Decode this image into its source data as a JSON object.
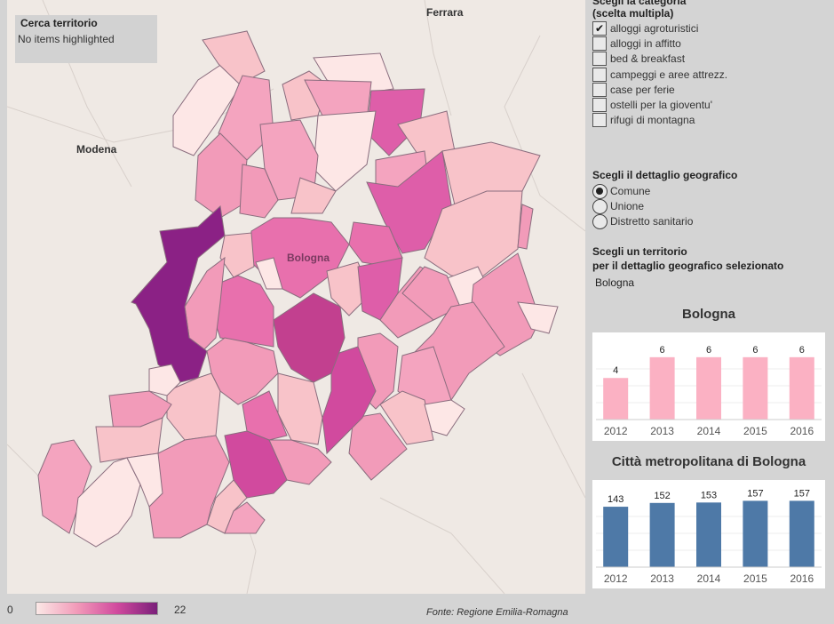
{
  "search": {
    "title": "Cerca territorio",
    "status": "No items highlighted"
  },
  "map": {
    "cities": {
      "modena": "Modena",
      "ferrara": "Ferrara",
      "bologna": "Bologna"
    },
    "legend": {
      "min": "0",
      "max": "22"
    },
    "source": "Fonte: Regione Emilia-Romagna"
  },
  "categories": {
    "title_line1": "Scegli la categoria",
    "title_line2": "(scelta multipla)",
    "items": [
      {
        "label": "alloggi agroturistici",
        "checked": true
      },
      {
        "label": "alloggi in affitto",
        "checked": false
      },
      {
        "label": "bed & breakfast",
        "checked": false
      },
      {
        "label": "campeggi e aree attrezz.",
        "checked": false
      },
      {
        "label": "case per ferie",
        "checked": false
      },
      {
        "label": "ostelli per la gioventu'",
        "checked": false
      },
      {
        "label": "rifugi di montagna",
        "checked": false
      }
    ]
  },
  "geo": {
    "title": "Scegli il dettaglio geografico",
    "options": [
      {
        "label": "Comune",
        "selected": true
      },
      {
        "label": "Unione",
        "selected": false
      },
      {
        "label": "Distretto sanitario",
        "selected": false
      }
    ]
  },
  "territory": {
    "title_line1": "Scegli un territorio",
    "title_line2": "per il dettaglio geografico selezionato",
    "value": "Bologna"
  },
  "colors": {
    "pink_bar": "#fbb1c3",
    "blue_bar": "#4e79a7"
  },
  "chart_data": [
    {
      "type": "bar",
      "title": "Bologna",
      "categories": [
        "2012",
        "2013",
        "2014",
        "2015",
        "2016"
      ],
      "values": [
        4,
        6,
        6,
        6,
        6
      ],
      "data_labels": [
        "4",
        "6",
        "6",
        "6",
        "6"
      ],
      "ylim": [
        0,
        6.5
      ],
      "color": "#fbb1c3"
    },
    {
      "type": "bar",
      "title": "Città metropolitana di Bologna",
      "categories": [
        "2012",
        "2013",
        "2014",
        "2015",
        "2016"
      ],
      "values": [
        143,
        152,
        153,
        157,
        157
      ],
      "data_labels": [
        "143",
        "152",
        "153",
        "157",
        "157"
      ],
      "ylim": [
        0,
        160
      ],
      "color": "#4e79a7"
    }
  ]
}
